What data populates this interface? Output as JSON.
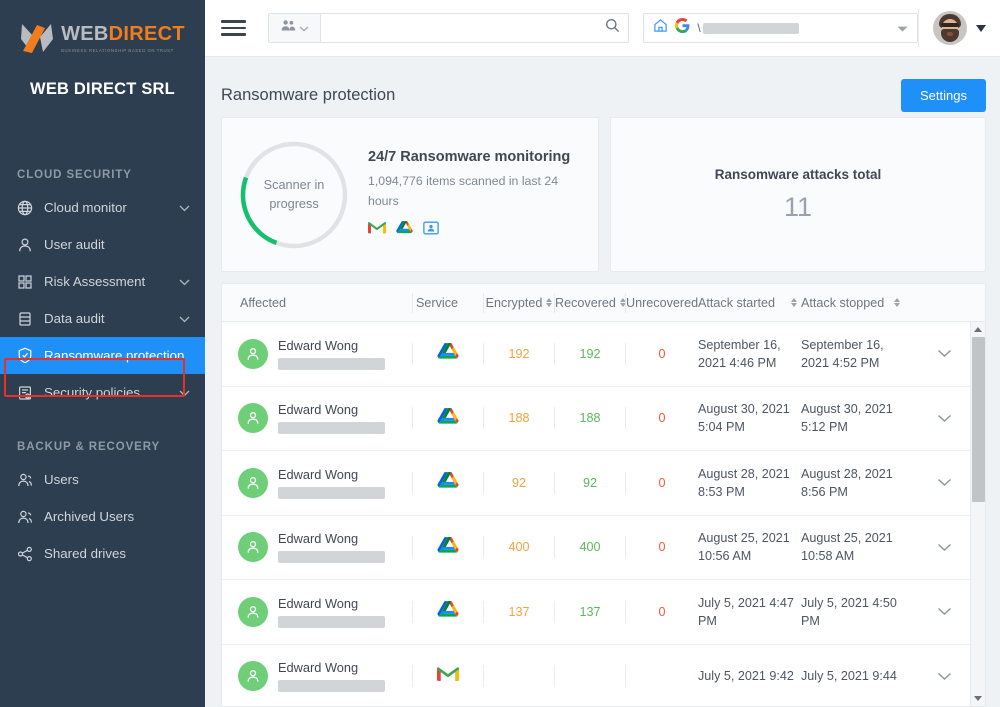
{
  "brand": {
    "logo_web": "WEB",
    "logo_direct": "DIRECT",
    "logo_tagline": "BUSINESS RELATIONSHIP BASED ON TRUST",
    "org_name": "WEB DIRECT SRL",
    "accent_blue": "#1e90f7",
    "sidebar_bg": "#2d3e50",
    "highlight_red": "#e8302a"
  },
  "sidebar": {
    "sections": [
      {
        "title": "CLOUD SECURITY",
        "items": [
          {
            "label": "Cloud monitor",
            "icon": "globe-icon",
            "chevron": true,
            "active": false
          },
          {
            "label": "User audit",
            "icon": "user-icon",
            "chevron": false,
            "active": false
          },
          {
            "label": "Risk Assessment",
            "icon": "grid-icon",
            "chevron": true,
            "active": false
          },
          {
            "label": "Data audit",
            "icon": "database-icon",
            "chevron": true,
            "active": false
          },
          {
            "label": "Ransomware protection",
            "icon": "shield-icon",
            "chevron": false,
            "active": true
          },
          {
            "label": "Security policies",
            "icon": "policy-icon",
            "chevron": true,
            "active": false
          }
        ]
      },
      {
        "title": "BACKUP & RECOVERY",
        "items": [
          {
            "label": "Users",
            "icon": "users-icon",
            "chevron": false,
            "active": false
          },
          {
            "label": "Archived Users",
            "icon": "users-archive-icon",
            "chevron": false,
            "active": false
          },
          {
            "label": "Shared drives",
            "icon": "share-icon",
            "chevron": false,
            "active": false
          }
        ]
      }
    ]
  },
  "topbar": {
    "menu_icon": "hamburger-icon",
    "scope_icon": "people-icon",
    "scope_chevron": "chevron-down-icon",
    "search_placeholder": "",
    "search_value": "",
    "search_icon": "search-icon",
    "domain_home_icon": "home-icon",
    "domain_google_icon": "google-g-icon",
    "domain_value": "\\",
    "domain_redacted": true,
    "domain_chevron": "chevron-down-icon",
    "avatar": "user-avatar-photo",
    "avatar_caret": "caret-down-icon"
  },
  "page": {
    "title": "Ransomware protection",
    "settings_button": "Settings"
  },
  "scanner_card": {
    "ring_label_line1": "Scanner in",
    "ring_label_line2": "progress",
    "progress_percent": 25,
    "ring_color": "#14c06e",
    "ring_track_color": "#e0e3e6",
    "title": "24/7 Ransomware monitoring",
    "subtitle": "1,094,776 items scanned in last 24 hours",
    "services": [
      "gmail-icon",
      "google-drive-icon",
      "google-contacts-icon"
    ]
  },
  "total_card": {
    "label": "Ransomware attacks total",
    "value": "11"
  },
  "table": {
    "columns": [
      {
        "label": "Affected",
        "sortable": false
      },
      {
        "label": "Service",
        "sortable": false
      },
      {
        "label": "Encrypted",
        "sortable": true
      },
      {
        "label": "Recovered",
        "sortable": true
      },
      {
        "label": "Unrecovered",
        "sortable": false
      },
      {
        "label": "Attack started",
        "sortable": true
      },
      {
        "label": "Attack stopped",
        "sortable": true
      }
    ],
    "rows": [
      {
        "name": "Edward Wong",
        "email_redacted": true,
        "service": "google-drive-icon",
        "encrypted": "192",
        "recovered": "192",
        "unrecovered": "0",
        "attack_started": "September 16, 2021 4:46 PM",
        "attack_stopped": "September 16, 2021 4:52 PM"
      },
      {
        "name": "Edward Wong",
        "email_redacted": true,
        "service": "google-drive-icon",
        "encrypted": "188",
        "recovered": "188",
        "unrecovered": "0",
        "attack_started": "August 30, 2021 5:04 PM",
        "attack_stopped": "August 30, 2021 5:12 PM"
      },
      {
        "name": "Edward Wong",
        "email_redacted": true,
        "service": "google-drive-icon",
        "encrypted": "92",
        "recovered": "92",
        "unrecovered": "0",
        "attack_started": "August 28, 2021 8:53 PM",
        "attack_stopped": "August 28, 2021 8:56 PM"
      },
      {
        "name": "Edward Wong",
        "email_redacted": true,
        "service": "google-drive-icon",
        "encrypted": "400",
        "recovered": "400",
        "unrecovered": "0",
        "attack_started": "August 25, 2021 10:56 AM",
        "attack_stopped": "August 25, 2021 10:58 AM"
      },
      {
        "name": "Edward Wong",
        "email_redacted": true,
        "service": "google-drive-icon",
        "encrypted": "137",
        "recovered": "137",
        "unrecovered": "0",
        "attack_started": "July 5, 2021 4:47 PM",
        "attack_stopped": "July 5, 2021 4:50 PM"
      },
      {
        "name": "Edward Wong",
        "email_redacted": true,
        "service": "gmail-icon",
        "encrypted": "",
        "recovered": "",
        "unrecovered": "",
        "attack_started": "July 5, 2021 9:42",
        "attack_stopped": "July 5, 2021 9:44"
      }
    ],
    "row_expand_icon": "chevron-down-icon",
    "scroll_up_icon": "triangle-up-icon",
    "scroll_down_icon": "triangle-down-icon"
  },
  "colors": {
    "encrypted": "#f2a33c",
    "recovered": "#5cb85c",
    "unrecovered": "#f05a3c",
    "avatar_green": "#6fcf78"
  }
}
